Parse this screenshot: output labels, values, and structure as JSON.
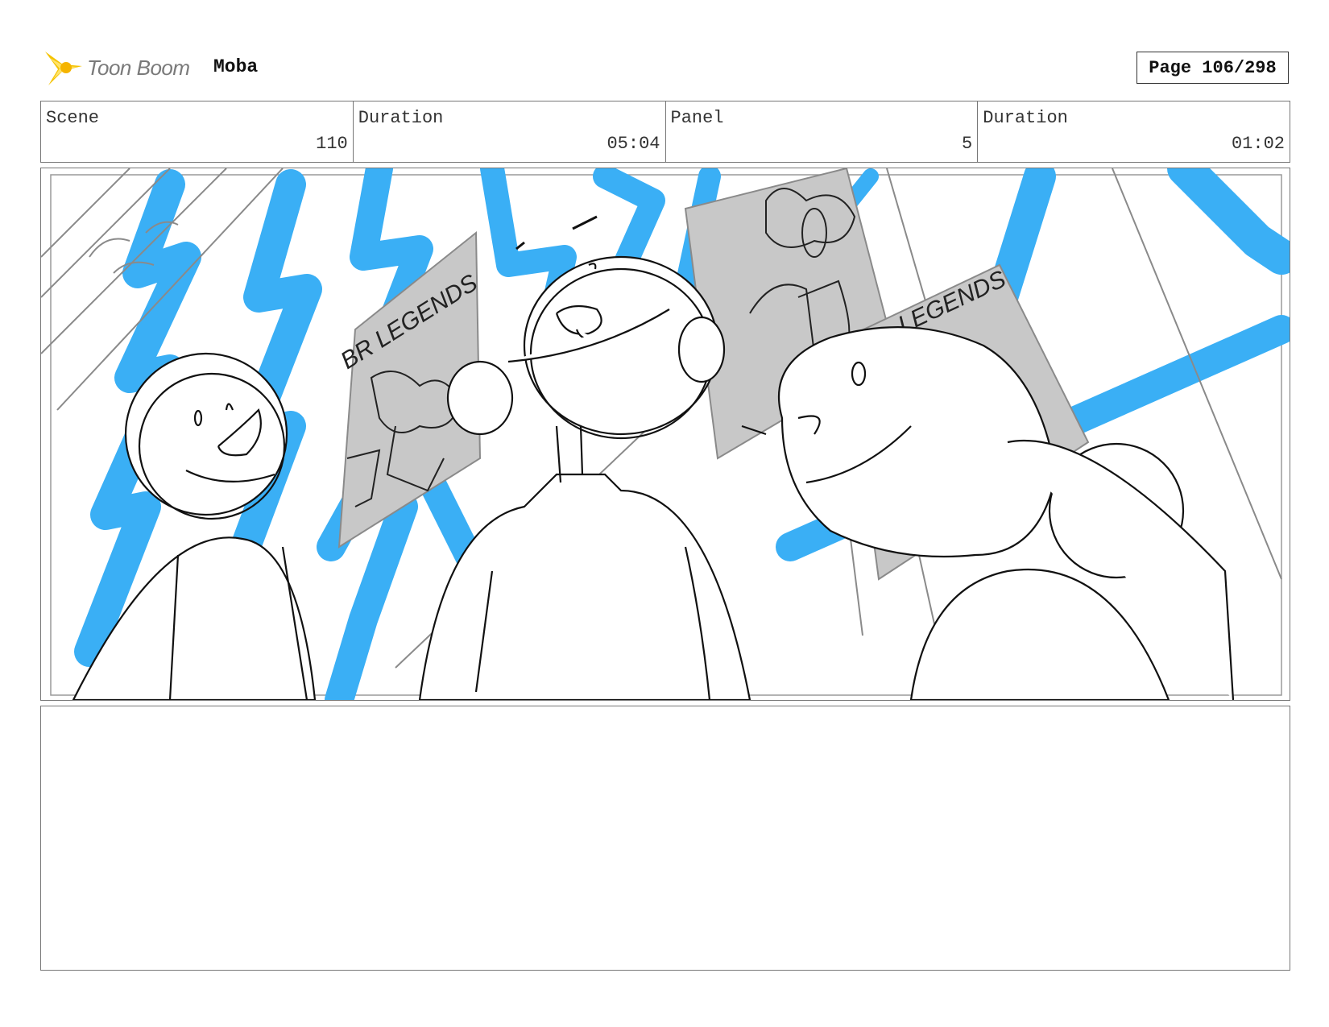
{
  "header": {
    "logo_name": "toon-boom-logo",
    "logo_text": "Toon Boom",
    "project_title": "Moba",
    "page_label": "Page 106/298"
  },
  "info": {
    "scene_label": "Scene",
    "scene_value": "110",
    "scene_duration_label": "Duration",
    "scene_duration_value": "05:04",
    "panel_label": "Panel",
    "panel_value": "5",
    "panel_duration_label": "Duration",
    "panel_duration_value": "01:02"
  },
  "sketch": {
    "poster_left_text": "BR LEGENDS",
    "poster_right_text": "LEGENDS",
    "accent_color": "#3aaff5",
    "poster_color": "#c8c8c8"
  },
  "notes": {
    "text": ""
  }
}
